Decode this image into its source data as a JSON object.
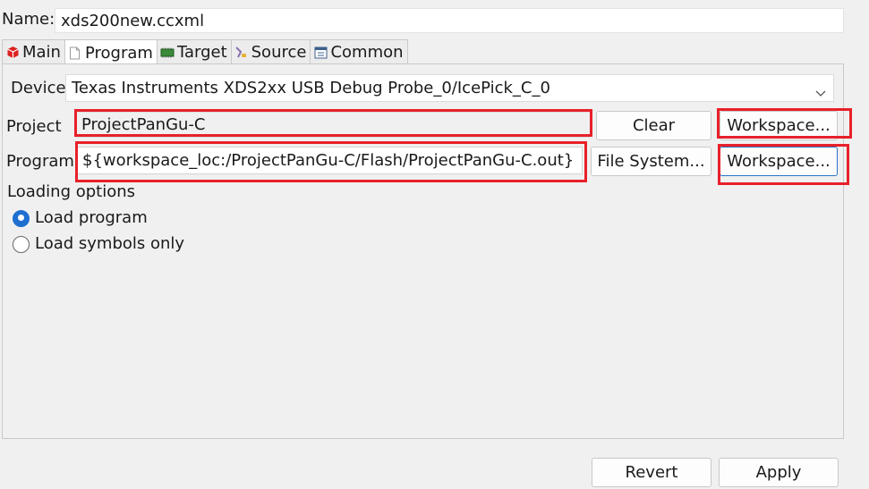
{
  "name_label": "Name:",
  "name_value": "xds200new.ccxml",
  "tabs": [
    {
      "label": "Main",
      "icon": "main-tab-icon"
    },
    {
      "label": "Program",
      "icon": "program-tab-icon"
    },
    {
      "label": "Target",
      "icon": "target-tab-icon"
    },
    {
      "label": "Source",
      "icon": "source-tab-icon"
    },
    {
      "label": "Common",
      "icon": "common-tab-icon"
    }
  ],
  "active_tab": "Program",
  "device": {
    "label": "Device",
    "value": "Texas Instruments XDS2xx USB Debug Probe_0/IcePick_C_0"
  },
  "project": {
    "label": "Project",
    "value": "ProjectPanGu-C",
    "clear_label": "Clear",
    "workspace_label": "Workspace..."
  },
  "program": {
    "label": "Program",
    "value": "${workspace_loc:/ProjectPanGu-C/Flash/ProjectPanGu-C.out}",
    "filesystem_label": "File System...",
    "workspace_label": "Workspace..."
  },
  "loading_options": {
    "title": "Loading options",
    "options": [
      {
        "label": "Load program",
        "selected": true
      },
      {
        "label": "Load symbols only",
        "selected": false
      }
    ]
  },
  "footer": {
    "revert_label": "Revert",
    "apply_label": "Apply"
  },
  "colors": {
    "highlight": "#e8202a",
    "radio_selected": "#1f6fd1",
    "background": "#f0f0f0"
  }
}
